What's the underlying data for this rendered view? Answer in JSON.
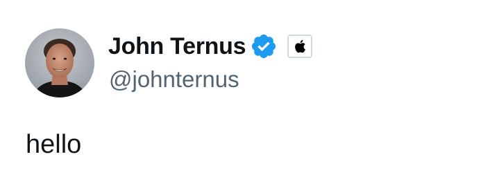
{
  "author": {
    "display_name": "John Ternus",
    "handle": "@johnternus",
    "verified_badge_icon": "verified-checkmark-badge",
    "verified_badge_color": "#1d9bf0",
    "affiliation_icon": "apple-logo-icon",
    "avatar_icon": "profile-photo"
  },
  "tweet": {
    "text": "hello"
  },
  "colors": {
    "name_text": "#0f1419",
    "handle_text": "#536471",
    "background": "#ffffff"
  }
}
